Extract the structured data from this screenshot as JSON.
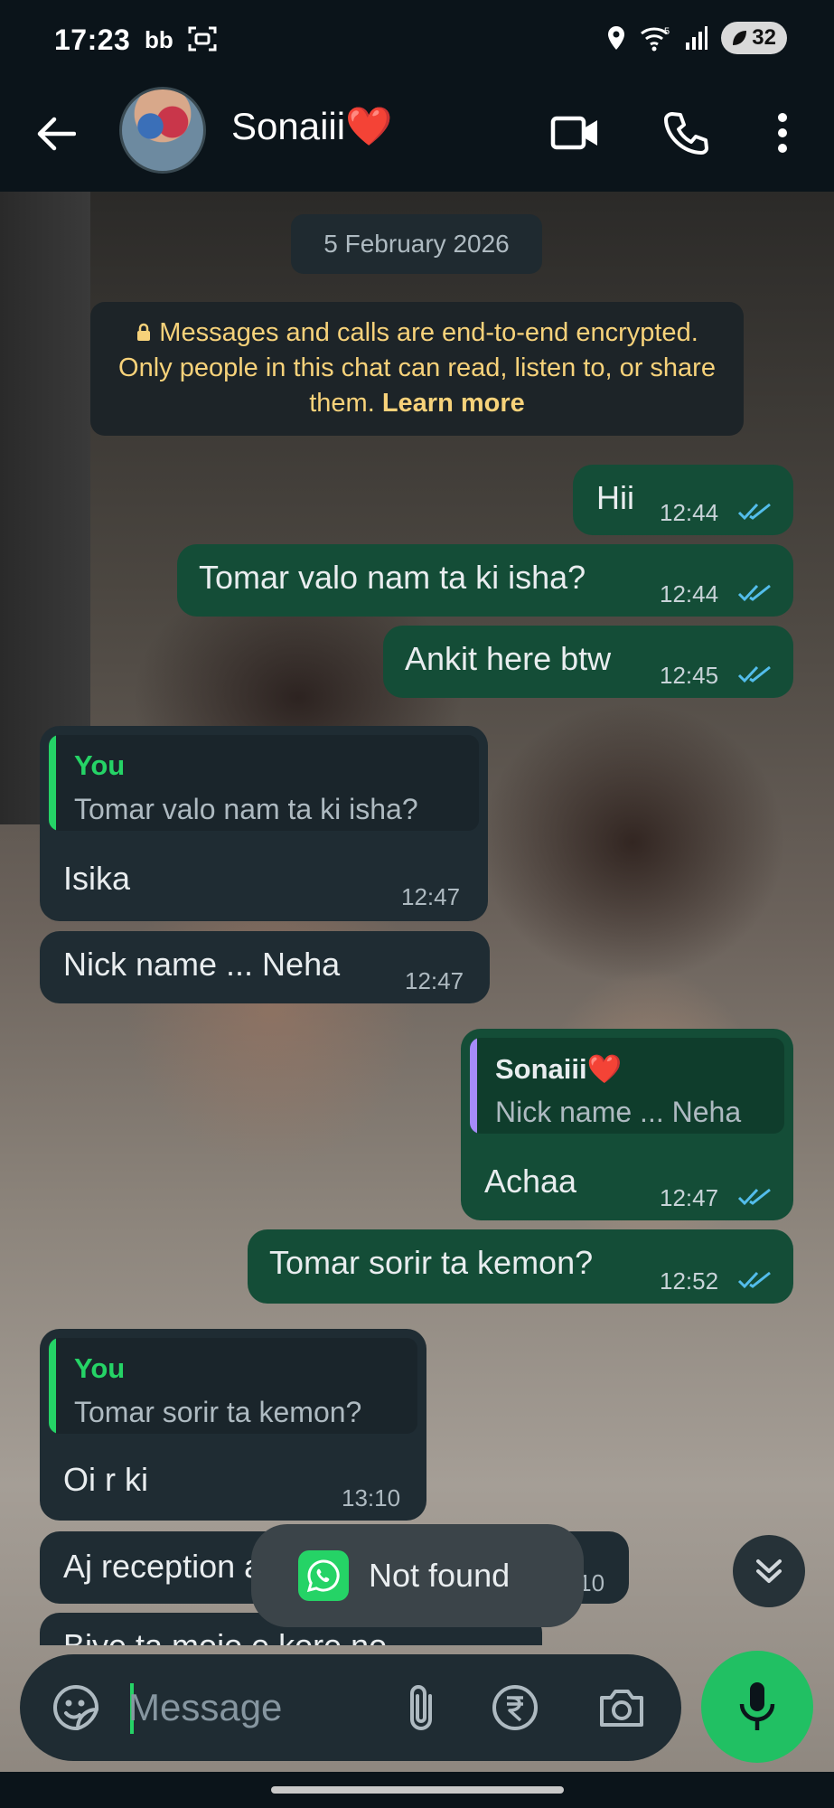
{
  "status_bar": {
    "time": "17:23",
    "battery": "32"
  },
  "header": {
    "contact_name": "Sonaiii❤️",
    "icons": [
      "back-arrow-icon",
      "video-call-icon",
      "voice-call-icon",
      "more-options-icon"
    ]
  },
  "chat": {
    "date_chip": "5 February 2026",
    "encryption": {
      "text": "Messages and calls are end-to-end encrypted. Only people in this chat can read, listen to, or share them.",
      "link": "Learn more"
    },
    "messages": [
      {
        "dir": "out",
        "text": "Hii",
        "time": "12:44",
        "status": "read"
      },
      {
        "dir": "out",
        "text": "Tomar valo nam ta ki isha?",
        "time": "12:44",
        "status": "read"
      },
      {
        "dir": "out",
        "text": "Ankit here btw",
        "time": "12:45",
        "status": "read"
      },
      {
        "dir": "in",
        "text": "Isika",
        "time": "12:47",
        "quote": {
          "name": "You",
          "text": "Tomar valo nam ta ki isha?"
        }
      },
      {
        "dir": "in",
        "text": "Nick name ... Neha",
        "time": "12:47"
      },
      {
        "dir": "out",
        "text": "Achaa",
        "time": "12:47",
        "status": "read",
        "quote": {
          "name": "Sonaiii❤️",
          "text": "Nick name ... Neha"
        }
      },
      {
        "dir": "out",
        "text": "Tomar sorir ta kemon?",
        "time": "12:52",
        "status": "read"
      },
      {
        "dir": "in",
        "text": "Oi r ki",
        "time": "13:10",
        "quote": {
          "name": "You",
          "text": "Tomar sorir ta kemon?"
        }
      },
      {
        "dir": "in",
        "text": "Aj reception a jete hobe abar",
        "time": "13:10"
      },
      {
        "dir": "in",
        "text": "Biye ta mojo e kore no",
        "time": ""
      }
    ]
  },
  "toast": {
    "text": "Not found"
  },
  "composer": {
    "placeholder": "Message",
    "icons": [
      "sticker-icon",
      "attach-icon",
      "rupee-payment-icon",
      "camera-icon",
      "mic-icon"
    ]
  },
  "colors": {
    "outgoing_bubble": "#144d37",
    "incoming_bubble": "#1f2c33",
    "accent_green": "#25d366",
    "read_ticks": "#53bdeb",
    "quote_you": "#25d366",
    "quote_contact": "#a78bfa",
    "encryption_text": "#f7d27a"
  }
}
